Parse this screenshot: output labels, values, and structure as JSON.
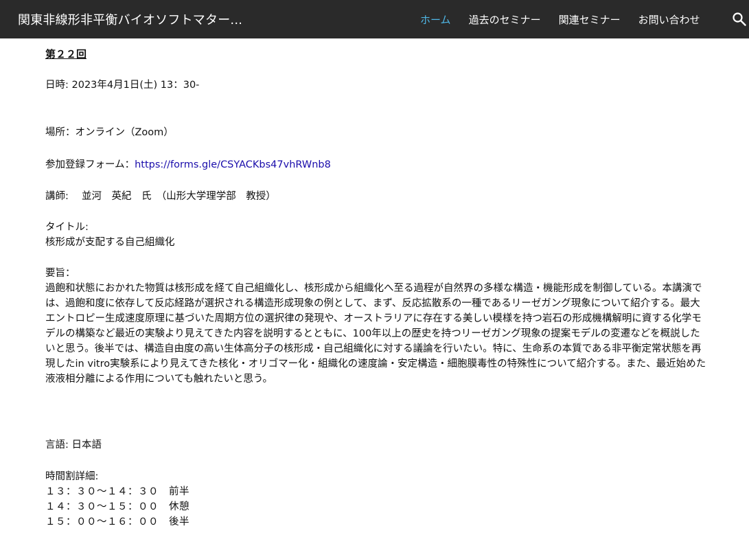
{
  "header": {
    "site_title": "関東非線形非平衡バイオソフトマター...",
    "nav": [
      {
        "label": "ホーム",
        "active": true
      },
      {
        "label": "過去のセミナー",
        "active": false
      },
      {
        "label": "関連セミナー",
        "active": false
      },
      {
        "label": "お問い合わせ",
        "active": false
      }
    ],
    "search_icon": "search-icon",
    "active_color": "#4fb7e6"
  },
  "seminar": {
    "number": "第２２回",
    "date": "日時: 2023年4月1日(土)  13：30-",
    "venue": "場所：オンライン（Zoom）",
    "registration_label": "参加登録フォーム：",
    "registration_url": "https://forms.gle/CSYACKbs47vhRWnb8",
    "lecturer": "講師:　 並河　英紀　氏　（山形大学理学部　教授）",
    "title_label": "タイトル:",
    "title": "核形成が支配する自己組織化",
    "abstract_label": "要旨：",
    "abstract": "過飽和状態におかれた物質は核形成を経て自己組織化し、核形成から組織化へ至る過程が自然界の多様な構造・機能形成を制御している。本講演では、過飽和度に依存して反応経路が選択される構造形成現象の例として、まず、反応拡散系の一種であるリーゼガング現象について紹介する。最大エントロピー生成速度原理に基づいた周期方位の選択律の発現や、オーストラリアに存在する美しい模様を持つ岩石の形成機構解明に資する化学モデルの構築など最近の実験より見えてきた内容を説明するとともに、100年以上の歴史を持つリーゼガング現象の提案モデルの変遷などを概説したいと思う。後半では、構造自由度の高い生体高分子の核形成・自己組織化に対する議論を行いたい。特に、生命系の本質である非平衡定常状態を再現したin vitro実験系により見えてきた核化・オリゴマー化・組織化の速度論・安定構造・細胞膜毒性の特殊性について紹介する。また、最近始めた液液相分離による作用についても触れたいと思う。",
    "language": "言語: 日本語",
    "schedule_label": "時間割詳細:",
    "schedule": [
      "１３：３０〜１４：３０　前半",
      "１４：３０〜１５：００　休憩",
      "１５：００〜１６：００　後半"
    ]
  }
}
